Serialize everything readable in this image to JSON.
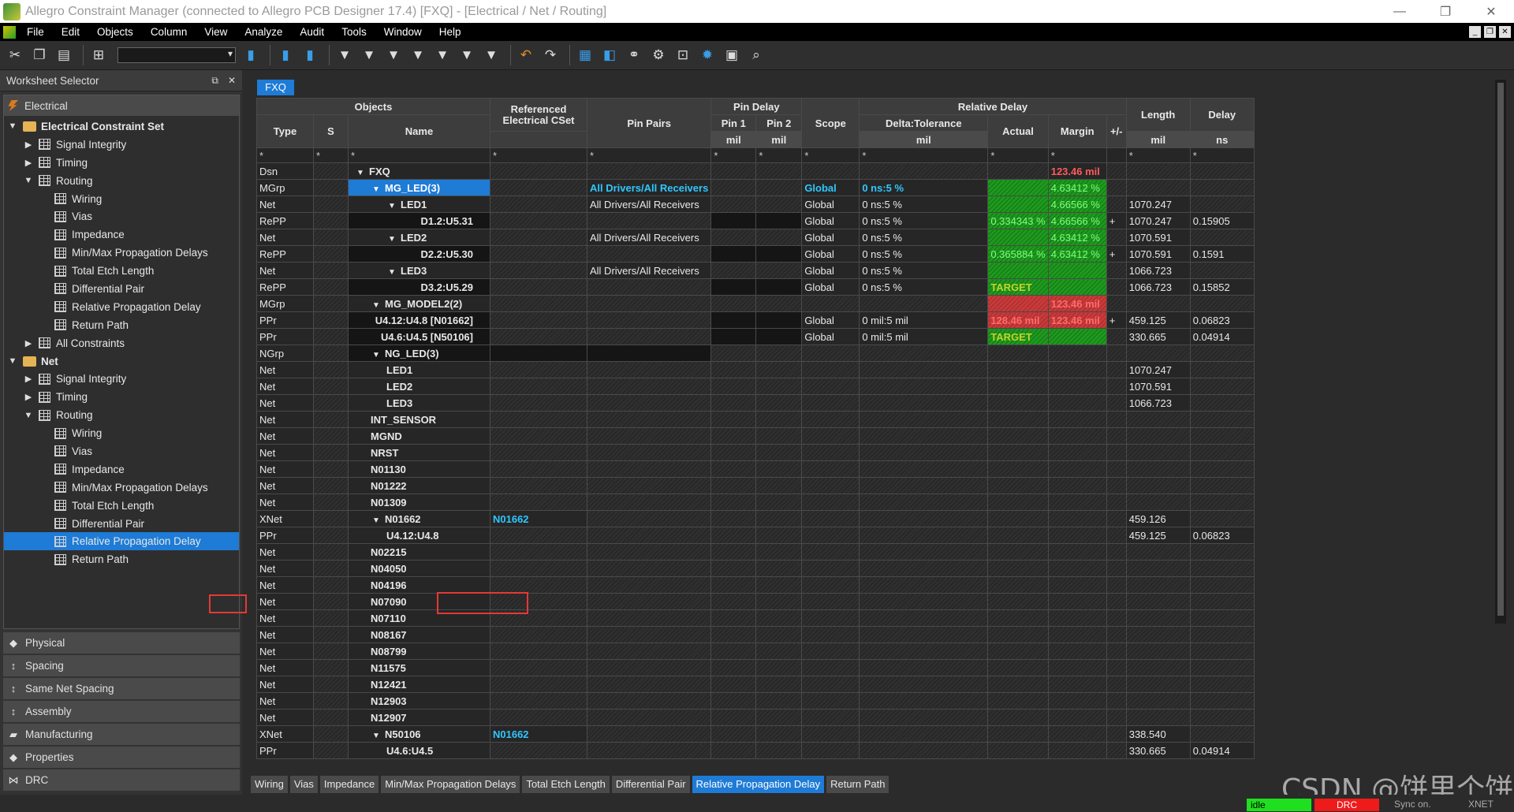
{
  "window": {
    "title": "Allegro Constraint Manager (connected to Allegro PCB Designer 17.4) [FXQ] - [Electrical / Net / Routing]"
  },
  "menu": [
    "File",
    "Edit",
    "Objects",
    "Column",
    "View",
    "Analyze",
    "Audit",
    "Tools",
    "Window",
    "Help"
  ],
  "worksheet": {
    "title": "Worksheet Selector",
    "category": "Electrical",
    "tree": [
      {
        "t": "Electrical Constraint Set",
        "lvl": 0,
        "tw": "▼",
        "icon": "folder",
        "bold": true
      },
      {
        "t": "Signal Integrity",
        "lvl": 1,
        "tw": "▶",
        "icon": "grid"
      },
      {
        "t": "Timing",
        "lvl": 1,
        "tw": "▶",
        "icon": "grid"
      },
      {
        "t": "Routing",
        "lvl": 1,
        "tw": "▼",
        "icon": "grid"
      },
      {
        "t": "Wiring",
        "lvl": 2,
        "tw": "",
        "icon": "grid"
      },
      {
        "t": "Vias",
        "lvl": 2,
        "tw": "",
        "icon": "grid"
      },
      {
        "t": "Impedance",
        "lvl": 2,
        "tw": "",
        "icon": "grid"
      },
      {
        "t": "Min/Max Propagation Delays",
        "lvl": 2,
        "tw": "",
        "icon": "grid"
      },
      {
        "t": "Total Etch Length",
        "lvl": 2,
        "tw": "",
        "icon": "grid"
      },
      {
        "t": "Differential Pair",
        "lvl": 2,
        "tw": "",
        "icon": "grid"
      },
      {
        "t": "Relative Propagation Delay",
        "lvl": 2,
        "tw": "",
        "icon": "grid"
      },
      {
        "t": "Return Path",
        "lvl": 2,
        "tw": "",
        "icon": "grid"
      },
      {
        "t": "All Constraints",
        "lvl": 1,
        "tw": "▶",
        "icon": "grid"
      },
      {
        "t": "Net",
        "lvl": 0,
        "tw": "▼",
        "icon": "folder",
        "bold": true
      },
      {
        "t": "Signal Integrity",
        "lvl": 1,
        "tw": "▶",
        "icon": "grid"
      },
      {
        "t": "Timing",
        "lvl": 1,
        "tw": "▶",
        "icon": "grid"
      },
      {
        "t": "Routing",
        "lvl": 1,
        "tw": "▼",
        "icon": "grid"
      },
      {
        "t": "Wiring",
        "lvl": 2,
        "tw": "",
        "icon": "grid"
      },
      {
        "t": "Vias",
        "lvl": 2,
        "tw": "",
        "icon": "grid"
      },
      {
        "t": "Impedance",
        "lvl": 2,
        "tw": "",
        "icon": "grid"
      },
      {
        "t": "Min/Max Propagation Delays",
        "lvl": 2,
        "tw": "",
        "icon": "grid"
      },
      {
        "t": "Total Etch Length",
        "lvl": 2,
        "tw": "",
        "icon": "grid"
      },
      {
        "t": "Differential Pair",
        "lvl": 2,
        "tw": "",
        "icon": "grid"
      },
      {
        "t": "Relative Propagation Delay",
        "lvl": 2,
        "tw": "",
        "icon": "grid",
        "sel": true
      },
      {
        "t": "Return Path",
        "lvl": 2,
        "tw": "",
        "icon": "grid"
      }
    ],
    "categories": [
      {
        "t": "Physical",
        "icon": "◆"
      },
      {
        "t": "Spacing",
        "icon": "↕"
      },
      {
        "t": "Same Net Spacing",
        "icon": "↕"
      },
      {
        "t": "Assembly",
        "icon": "↕"
      },
      {
        "t": "Manufacturing",
        "icon": "▰"
      },
      {
        "t": "Properties",
        "icon": "◆"
      },
      {
        "t": "DRC",
        "icon": "⋈"
      }
    ]
  },
  "sheet": {
    "tab": "FXQ",
    "headers": {
      "objects": "Objects",
      "type": "Type",
      "s": "S",
      "name": "Name",
      "refcset": "Referenced Electrical CSet",
      "pinpairs": "Pin Pairs",
      "pindelay": "Pin Delay",
      "pin1": "Pin 1",
      "pin2": "Pin 2",
      "scope": "Scope",
      "reldelay": "Relative Delay",
      "delta": "Delta:Tolerance",
      "actual": "Actual",
      "margin": "Margin",
      "pm": "+/-",
      "length": "Length",
      "delay": "Delay",
      "u_mil": "mil",
      "u_ns": "ns",
      "star": "*"
    },
    "rows": [
      {
        "type": "Dsn",
        "ind": 0,
        "tw": "▼",
        "name": "FXQ",
        "margin": "123.46 mil",
        "mc": "redt"
      },
      {
        "type": "MGrp",
        "ind": 1,
        "tw": "▼",
        "name": "MG_LED(3)",
        "sel": true,
        "pin": "All Drivers/All Receivers",
        "pinc": "cy",
        "scope": "Global",
        "sc": "cy",
        "delta": "0 ns:5 %",
        "dc": "cy",
        "actual": "",
        "ac": "g",
        "margin": "4.63412 %",
        "mc": "g"
      },
      {
        "type": "Net",
        "ind": 2,
        "tw": "▼",
        "name": "LED1",
        "pin": "All Drivers/All Receivers",
        "scope": "Global",
        "delta": "0 ns:5 %",
        "actual": "",
        "ac": "g",
        "margin": "4.66566 %",
        "mc": "g",
        "len": "1070.247"
      },
      {
        "type": "RePP",
        "ind": 3,
        "tw": "",
        "name": "D1.2:U5.31",
        "right": true,
        "dk": true,
        "scope": "Global",
        "delta": "0 ns:5 %",
        "actual": "0.334343 %",
        "ac": "g",
        "margin": "4.66566 %",
        "mc": "g",
        "pm": "+",
        "len": "1070.247",
        "dly": "0.15905"
      },
      {
        "type": "Net",
        "ind": 2,
        "tw": "▼",
        "name": "LED2",
        "pin": "All Drivers/All Receivers",
        "scope": "Global",
        "delta": "0 ns:5 %",
        "actual": "",
        "ac": "g",
        "margin": "4.63412 %",
        "mc": "g",
        "len": "1070.591"
      },
      {
        "type": "RePP",
        "ind": 3,
        "tw": "",
        "name": "D2.2:U5.30",
        "right": true,
        "dk": true,
        "scope": "Global",
        "delta": "0 ns:5 %",
        "actual": "0.365884 %",
        "ac": "g",
        "margin": "4.63412 %",
        "mc": "g",
        "pm": "+",
        "len": "1070.591",
        "dly": "0.1591"
      },
      {
        "type": "Net",
        "ind": 2,
        "tw": "▼",
        "name": "LED3",
        "pin": "All Drivers/All Receivers",
        "scope": "Global",
        "delta": "0 ns:5 %",
        "actual": "",
        "ac": "g",
        "margin": "",
        "mc": "g",
        "len": "1066.723"
      },
      {
        "type": "RePP",
        "ind": 3,
        "tw": "",
        "name": "D3.2:U5.29",
        "right": true,
        "dk": true,
        "scope": "Global",
        "delta": "0 ns:5 %",
        "actual": "TARGET",
        "ac": "gt",
        "margin": "",
        "mc": "g",
        "len": "1066.723",
        "dly": "0.15852"
      },
      {
        "type": "MGrp",
        "ind": 1,
        "tw": "▼",
        "name": "MG_MODEL2(2)",
        "actual": "",
        "ac": "r",
        "margin": "123.46 mil",
        "mc": "r"
      },
      {
        "type": "PPr",
        "ind": 3,
        "tw": "",
        "name": "U4.12:U4.8 [N01662]",
        "right": true,
        "dk": true,
        "scope": "Global",
        "delta": "0 mil:5 mil",
        "actual": "128.46 mil",
        "ac": "r",
        "margin": "123.46 mil",
        "mc": "r",
        "pm": "+",
        "len": "459.125",
        "dly": "0.06823"
      },
      {
        "type": "PPr",
        "ind": 3,
        "tw": "",
        "name": "U4.6:U4.5 [N50106]",
        "right": true,
        "dk": true,
        "scope": "Global",
        "delta": "0 mil:5 mil",
        "actual": "TARGET",
        "ac": "gt",
        "margin": "",
        "mc": "g",
        "len": "330.665",
        "dly": "0.04914"
      },
      {
        "type": "NGrp",
        "ind": 1,
        "tw": "▼",
        "name": "NG_LED(3)",
        "dkall": true
      },
      {
        "type": "Net",
        "ind": 2,
        "tw": "",
        "name": "LED1",
        "len": "1070.247"
      },
      {
        "type": "Net",
        "ind": 2,
        "tw": "",
        "name": "LED2",
        "len": "1070.591"
      },
      {
        "type": "Net",
        "ind": 2,
        "tw": "",
        "name": "LED3",
        "len": "1066.723"
      },
      {
        "type": "Net",
        "ind": 1,
        "tw": "",
        "name": "INT_SENSOR"
      },
      {
        "type": "Net",
        "ind": 1,
        "tw": "",
        "name": "MGND"
      },
      {
        "type": "Net",
        "ind": 1,
        "tw": "",
        "name": "NRST"
      },
      {
        "type": "Net",
        "ind": 1,
        "tw": "",
        "name": "N01130"
      },
      {
        "type": "Net",
        "ind": 1,
        "tw": "",
        "name": "N01222"
      },
      {
        "type": "Net",
        "ind": 1,
        "tw": "",
        "name": "N01309"
      },
      {
        "type": "XNet",
        "ind": 1,
        "tw": "▼",
        "name": "N01662",
        "ref": "N01662",
        "len": "459.126"
      },
      {
        "type": "PPr",
        "ind": 2,
        "tw": "",
        "name": "U4.12:U4.8",
        "len": "459.125",
        "dly": "0.06823"
      },
      {
        "type": "Net",
        "ind": 1,
        "tw": "",
        "name": "N02215"
      },
      {
        "type": "Net",
        "ind": 1,
        "tw": "",
        "name": "N04050"
      },
      {
        "type": "Net",
        "ind": 1,
        "tw": "",
        "name": "N04196"
      },
      {
        "type": "Net",
        "ind": 1,
        "tw": "",
        "name": "N07090"
      },
      {
        "type": "Net",
        "ind": 1,
        "tw": "",
        "name": "N07110"
      },
      {
        "type": "Net",
        "ind": 1,
        "tw": "",
        "name": "N08167"
      },
      {
        "type": "Net",
        "ind": 1,
        "tw": "",
        "name": "N08799"
      },
      {
        "type": "Net",
        "ind": 1,
        "tw": "",
        "name": "N11575"
      },
      {
        "type": "Net",
        "ind": 1,
        "tw": "",
        "name": "N12421"
      },
      {
        "type": "Net",
        "ind": 1,
        "tw": "",
        "name": "N12903"
      },
      {
        "type": "Net",
        "ind": 1,
        "tw": "",
        "name": "N12907"
      },
      {
        "type": "XNet",
        "ind": 1,
        "tw": "▼",
        "name": "N50106",
        "ref": "N01662",
        "len": "338.540"
      },
      {
        "type": "PPr",
        "ind": 2,
        "tw": "",
        "name": "U4.6:U4.5",
        "len": "330.665",
        "dly": "0.04914"
      }
    ]
  },
  "bottom_tabs": [
    {
      "t": "Wiring"
    },
    {
      "t": "Vias"
    },
    {
      "t": "Impedance"
    },
    {
      "t": "Min/Max Propagation Delays"
    },
    {
      "t": "Total Etch Length"
    },
    {
      "t": "Differential Pair"
    },
    {
      "t": "Relative Propagation Delay",
      "act": true
    },
    {
      "t": "Return Path"
    }
  ],
  "status": {
    "idle": "idle",
    "drc": "DRC",
    "sync": "Sync on.",
    "xnet": "XNET"
  },
  "watermark": "CSDN @饼里个饼",
  "colors": {
    "accent": "#1e7bd6",
    "pass": "#1e9a1e",
    "fail": "#c93a3a",
    "idle": "#1fe01f",
    "drc": "#ef1b1b"
  }
}
